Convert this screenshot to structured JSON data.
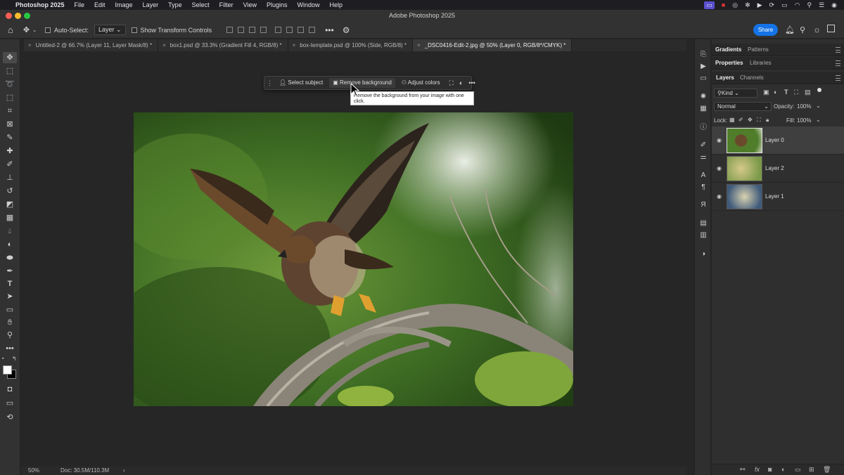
{
  "menubar": {
    "app_name": "Photoshop 2025",
    "menus": [
      "File",
      "Edit",
      "Image",
      "Layer",
      "Type",
      "Select",
      "Filter",
      "View",
      "Plugins",
      "Window",
      "Help"
    ]
  },
  "window": {
    "title": "Adobe Photoshop 2025"
  },
  "options_bar": {
    "auto_select_label": "Auto-Select:",
    "auto_select_value": "Layer",
    "transform_label": "Show Transform Controls",
    "share_label": "Share"
  },
  "tabs": [
    {
      "label": "Untitled-2 @ 66.7% (Layer 11, Layer Mask/8) *"
    },
    {
      "label": "box1.psd @ 33.3% (Gradient Fill 4, RGB/8) *"
    },
    {
      "label": "box-template.psd @ 100% (Side, RGB/8) *"
    },
    {
      "label": "_DSC0416-Edit-2.jpg @ 50% (Layer 0, RGB/8*/CMYK) *"
    }
  ],
  "context_bar": {
    "select_subject": "Select subject",
    "remove_background": "Remove background",
    "adjust_colors": "Adjust colors"
  },
  "tooltip": {
    "text": "Remove the background from your image with one click."
  },
  "status": {
    "zoom": "50%",
    "doc": "Doc: 30.5M/110.3M"
  },
  "panels": {
    "top_tabs": [
      "Gradients",
      "Patterns"
    ],
    "mid_tabs": [
      "Properties",
      "Libraries"
    ],
    "layer_tabs": [
      "Layers",
      "Channels"
    ],
    "kind_label": "Kind",
    "blend_mode": "Normal",
    "opacity_label": "Opacity:",
    "opacity_value": "100%",
    "lock_label": "Lock:",
    "fill_label": "Fill:",
    "fill_value": "100%"
  },
  "layers": [
    {
      "name": "Layer 0",
      "selected": true
    },
    {
      "name": "Layer 2",
      "selected": false
    },
    {
      "name": "Layer 1",
      "selected": false
    }
  ]
}
